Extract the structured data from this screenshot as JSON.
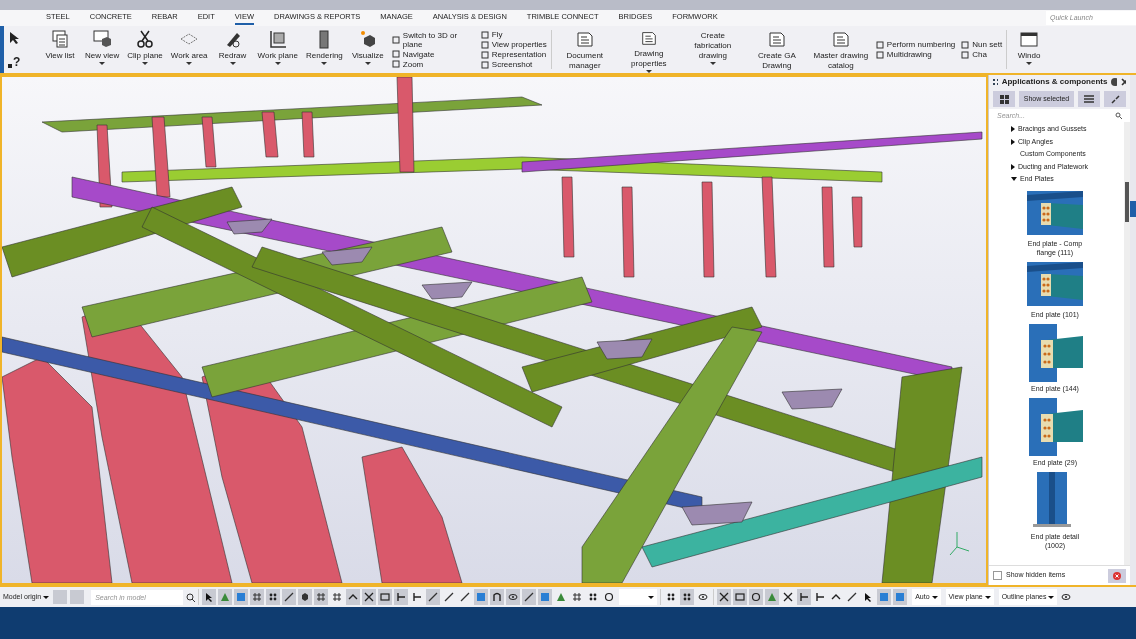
{
  "menu_tabs": [
    {
      "label": "STEEL",
      "selected": false
    },
    {
      "label": "CONCRETE",
      "selected": false
    },
    {
      "label": "REBAR",
      "selected": false
    },
    {
      "label": "EDIT",
      "selected": false
    },
    {
      "label": "VIEW",
      "selected": true
    },
    {
      "label": "DRAWINGS & REPORTS",
      "selected": false
    },
    {
      "label": "MANAGE",
      "selected": false
    },
    {
      "label": "ANALYSIS & DESIGN",
      "selected": false
    },
    {
      "label": "TRIMBLE CONNECT",
      "selected": false
    },
    {
      "label": "BRIDGES",
      "selected": false
    },
    {
      "label": "FORMWORK",
      "selected": false
    }
  ],
  "quick_launch": {
    "placeholder": "Quick Launch"
  },
  "help_pointer_glyph": "?",
  "ribbon": [
    {
      "kind": "large",
      "label": "View list",
      "dropdown": false
    },
    {
      "kind": "large",
      "label": "New view",
      "dropdown": true
    },
    {
      "kind": "large",
      "label": "Clip plane",
      "dropdown": true
    },
    {
      "kind": "large",
      "label": "Work area",
      "dropdown": true
    },
    {
      "kind": "large",
      "label": "Redraw",
      "dropdown": true
    },
    {
      "kind": "large",
      "label": "Work plane",
      "dropdown": true
    },
    {
      "kind": "large",
      "label": "Rendering",
      "dropdown": true
    },
    {
      "kind": "large",
      "label": "Visualize",
      "dropdown": true
    },
    {
      "kind": "stack",
      "entries": [
        "Switch to 3D or plane",
        "Navigate",
        "Zoom"
      ]
    },
    {
      "kind": "stack",
      "entries": [
        "Fly",
        "View properties",
        "Representation",
        "Screenshot"
      ]
    },
    {
      "kind": "separator"
    },
    {
      "kind": "large",
      "label": "Document manager",
      "dropdown": false
    },
    {
      "kind": "large",
      "label": "Drawing properties",
      "dropdown": true
    },
    {
      "kind": "large",
      "label": "Create fabrication drawing",
      "dropdown": true
    },
    {
      "kind": "large",
      "label": "Create GA Drawing",
      "dropdown": false
    },
    {
      "kind": "large",
      "label": "Master drawing catalog",
      "dropdown": false
    },
    {
      "kind": "stack",
      "entries": [
        "Perform numbering",
        "Multidrawing"
      ]
    },
    {
      "kind": "stack",
      "entries": [
        "Nun sett",
        "Cha"
      ]
    },
    {
      "kind": "separator"
    },
    {
      "kind": "large",
      "label": "Windo",
      "dropdown": true
    }
  ],
  "panel": {
    "title": "Applications & components",
    "show_selected": "Show selected",
    "search": {
      "placeholder": "Search..."
    },
    "tree": [
      {
        "label": "Bracings and Gussets",
        "kind": "folder",
        "expanded": false
      },
      {
        "label": "Clip Angles",
        "kind": "folder",
        "expanded": false
      },
      {
        "label": "Custom Components",
        "kind": "leaf",
        "expanded": false
      },
      {
        "label": "Ducting and Platework",
        "kind": "folder",
        "expanded": false
      },
      {
        "label": "End Plates",
        "kind": "folder",
        "expanded": true,
        "children": [
          {
            "label": "End plate - Comp flange (111)",
            "kind": "beam-flange"
          },
          {
            "label": "End plate (101)",
            "kind": "beam-flange"
          },
          {
            "label": "End plate (144)",
            "kind": "column-beam"
          },
          {
            "label": "End plate (29)",
            "kind": "column-beam"
          },
          {
            "label": "End plate detail (1002)",
            "kind": "column"
          }
        ]
      }
    ],
    "show_hidden": {
      "label": "Show hidden items",
      "checked": false
    }
  },
  "status_bar": {
    "origin": "Model origin",
    "search": {
      "placeholder": "Search in model"
    },
    "tools": [
      {
        "kind": "arrow",
        "pressed": true
      },
      {
        "kind": "triangle",
        "pressed": true
      },
      {
        "kind": "square",
        "pressed": true
      },
      {
        "kind": "grid",
        "pressed": true
      },
      {
        "kind": "dots",
        "pressed": true
      },
      {
        "kind": "line",
        "pressed": true
      },
      {
        "kind": "cube",
        "pressed": true
      },
      {
        "kind": "grid",
        "pressed": true
      },
      {
        "kind": "grid",
        "pressed": false
      },
      {
        "kind": "caret",
        "pressed": true
      },
      {
        "kind": "cross",
        "pressed": true
      },
      {
        "kind": "rect",
        "pressed": true
      },
      {
        "kind": "tee",
        "pressed": true
      },
      {
        "kind": "tee",
        "pressed": false
      },
      {
        "kind": "line",
        "pressed": true
      },
      {
        "kind": "line",
        "pressed": false
      },
      {
        "kind": "line",
        "pressed": false
      },
      {
        "kind": "square",
        "pressed": true
      },
      {
        "kind": "arch",
        "pressed": true
      },
      {
        "kind": "eye",
        "pressed": true
      },
      {
        "kind": "line",
        "pressed": true
      },
      {
        "kind": "square",
        "pressed": true
      },
      {
        "kind": "triangle",
        "pressed": false
      },
      {
        "kind": "grid",
        "pressed": false
      },
      {
        "kind": "dots",
        "pressed": false
      },
      {
        "kind": "circle",
        "pressed": false
      }
    ],
    "snap_tools": [
      {
        "kind": "dots",
        "pressed": false
      },
      {
        "kind": "dots",
        "pressed": true
      },
      {
        "kind": "eye",
        "pressed": false
      }
    ],
    "shape_tools": [
      {
        "kind": "cross",
        "pressed": true
      },
      {
        "kind": "rect",
        "pressed": true
      },
      {
        "kind": "circle",
        "pressed": true
      },
      {
        "kind": "triangle",
        "pressed": true
      },
      {
        "kind": "cross",
        "pressed": false
      },
      {
        "kind": "tee",
        "pressed": true
      },
      {
        "kind": "tee",
        "pressed": false
      },
      {
        "kind": "caret",
        "pressed": false
      },
      {
        "kind": "line",
        "pressed": false
      },
      {
        "kind": "arrow",
        "pressed": false
      },
      {
        "kind": "square",
        "pressed": true
      },
      {
        "kind": "square",
        "pressed": true
      }
    ],
    "dropdowns": [
      "Auto",
      "View plane",
      "Outline planes"
    ]
  }
}
